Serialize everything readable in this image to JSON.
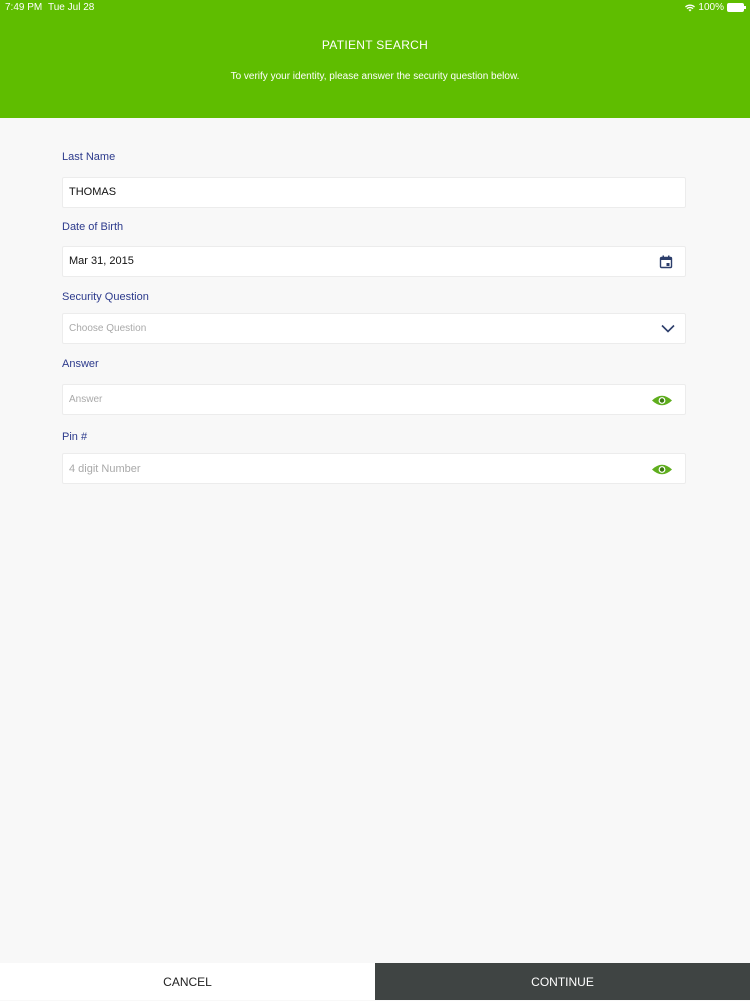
{
  "status_bar": {
    "time": "7:49 PM",
    "date": "Tue Jul 28",
    "battery": "100%"
  },
  "header": {
    "title": "PATIENT SEARCH",
    "subtitle": "To verify your identity, please answer the security question below."
  },
  "form": {
    "last_name": {
      "label": "Last Name",
      "value": "THOMAS"
    },
    "dob": {
      "label": "Date of Birth",
      "value": "Mar 31, 2015",
      "icon": "calendar-icon"
    },
    "security_question": {
      "label": "Security Question",
      "placeholder": "Choose Question",
      "icon": "chevron-down-icon"
    },
    "answer": {
      "label": "Answer",
      "placeholder": "Answer",
      "icon": "eye-icon"
    },
    "pin": {
      "label": "Pin #",
      "placeholder": "4 digit Number",
      "icon": "eye-icon"
    }
  },
  "footer": {
    "cancel_label": "CANCEL",
    "continue_label": "CONTINUE"
  },
  "colors": {
    "header_bg": "#5fbd00",
    "label": "#2c3a8c",
    "eye_icon": "#5fae1e",
    "continue_bg": "#3f4443"
  }
}
